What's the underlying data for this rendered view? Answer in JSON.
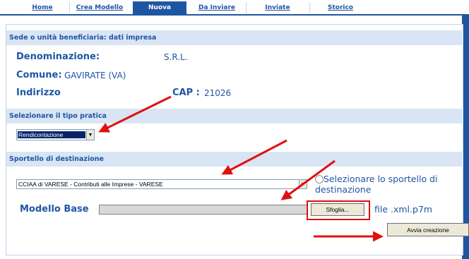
{
  "tabs": [
    {
      "label": "Home",
      "active": false
    },
    {
      "label": "Crea Modello",
      "active": false
    },
    {
      "label": "Nuova",
      "active": true
    },
    {
      "label": "Da Inviare",
      "active": false
    },
    {
      "label": "Inviate",
      "active": false
    },
    {
      "label": "Storico",
      "active": false
    }
  ],
  "section1": {
    "title": "Sede o unità beneficiaria: dati impresa",
    "denominazione_label": "Denominazione:",
    "denominazione_value": "S.R.L.",
    "comune_label": "Comune:",
    "comune_value": "GAVIRATE  (VA)",
    "indirizzo_label": "Indirizzo",
    "cap_label": "CAP :",
    "cap_value": "21026"
  },
  "section2": {
    "title": "Selezionare il tipo pratica",
    "tipo_pratica_selected": "Rendicontazione"
  },
  "section3": {
    "title": "Sportello di destinazione",
    "sportello_selected": "CCIAA di VARESE - Contributi alle Imprese - VARESE",
    "radio_label": "Selezionare lo sportello di destinazione",
    "modello_base_label": "Modello Base",
    "browse_button": "Sfoglia...",
    "file_hint": "file .xml.p7m",
    "create_button": "Avvia creazione"
  },
  "colors": {
    "brand_blue": "#1f56a3",
    "section_bg": "#d9e5f4",
    "annotation_red": "#e01010"
  }
}
